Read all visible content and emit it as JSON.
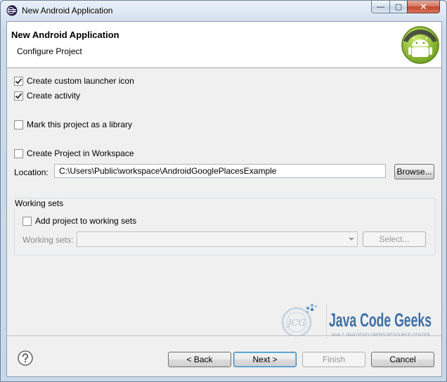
{
  "window": {
    "title": "New Android Application",
    "controls": {
      "minimize": "—",
      "maximize": "▢",
      "close": "✕"
    }
  },
  "header": {
    "title": "New Android Application",
    "subtitle": "Configure Project"
  },
  "options": {
    "custom_launcher_icon": {
      "label": "Create custom launcher icon",
      "checked": true
    },
    "create_activity": {
      "label": "Create activity",
      "checked": true
    },
    "mark_library": {
      "label": "Mark this project as a library",
      "checked": false
    },
    "create_in_workspace": {
      "label": "Create Project in Workspace",
      "checked": false
    }
  },
  "location": {
    "label": "Location:",
    "value": "C:\\Users\\Public\\workspace\\AndroidGooglePlacesExample",
    "browse_label": "Browse..."
  },
  "working_sets": {
    "legend": "Working sets",
    "add_label": "Add project to working sets",
    "add_checked": false,
    "sets_label": "Working sets:",
    "sets_value": "",
    "select_label": "Select..."
  },
  "watermark": {
    "brand": "Java Code Geeks",
    "tagline": "JAVA 2 JAVA DEVELOPERS RESOURCE CENTER",
    "monogram": "JCG"
  },
  "footer": {
    "back_label": "< Back",
    "next_label": "Next >",
    "finish_label": "Finish",
    "cancel_label": "Cancel"
  },
  "colors": {
    "android_green": "#9bc43c",
    "jcg_blue": "#3e6fa6",
    "default_button_border": "#3c7fb1"
  },
  "icons": {
    "app": "eclipse-icon",
    "header": "android-logo-icon",
    "help": "help-icon"
  }
}
